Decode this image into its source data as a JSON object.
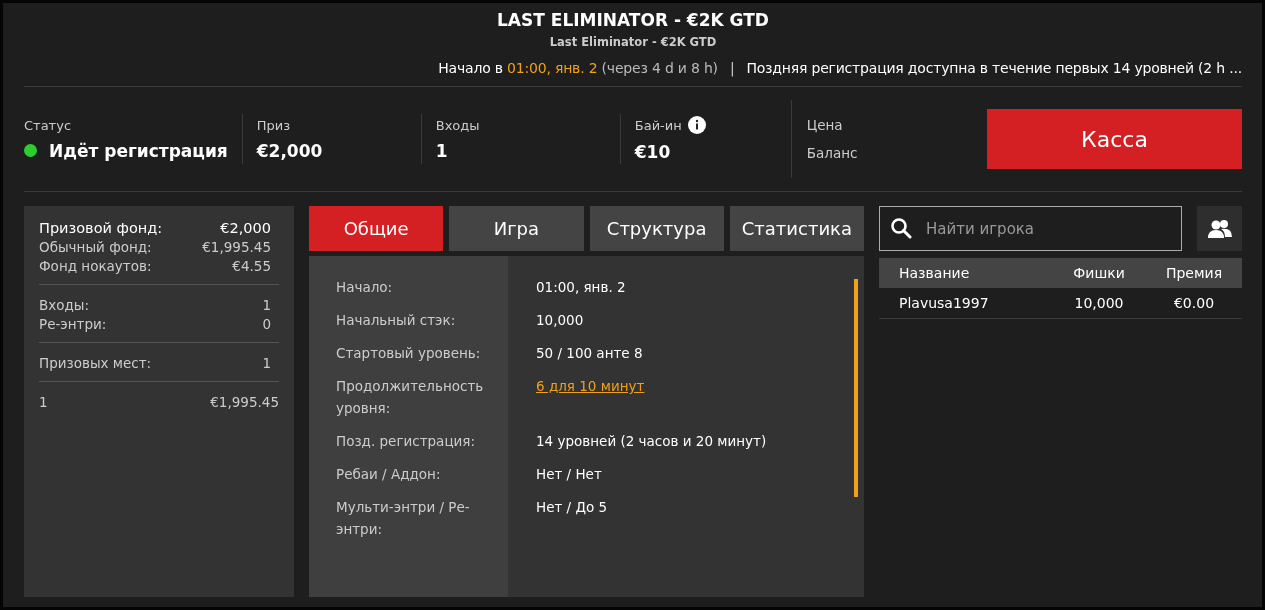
{
  "header": {
    "title": "LAST ELIMINATOR - €2K GTD",
    "subtitle": "Last Eliminator - €2K GTD",
    "start": {
      "prefix": "Начало в ",
      "time": "01:00, янв. 2",
      "suffix": " (через 4 d и 8 h)"
    },
    "separator": "|",
    "late_registration": "Поздняя регистрация доступна в течение первых 14 уровней (2 h ..."
  },
  "stats": [
    {
      "label": "Статус",
      "value": "Идёт регистрация",
      "kind": "status"
    },
    {
      "label": "Приз",
      "value": "€2,000",
      "kind": "plain"
    },
    {
      "label": "Входы",
      "value": "1",
      "kind": "plain"
    },
    {
      "label": "Бай-ин",
      "value": "€10",
      "kind": "info"
    }
  ],
  "balance": {
    "price_label": "Цена",
    "balance_label": "Баланс"
  },
  "cashier_button": "Касса",
  "summary": [
    [
      {
        "label": "Призовой фонд:",
        "value": "€2,000",
        "bold": true
      },
      {
        "label": "Обычный фонд:",
        "value": "€1,995.45",
        "bold": false
      },
      {
        "label": "Фонд нокаутов:",
        "value": "€4.55",
        "bold": false
      }
    ],
    [
      {
        "label": "Входы:",
        "value": "1",
        "bold": false
      },
      {
        "label": "Ре-энтри:",
        "value": "0",
        "bold": false
      }
    ],
    [
      {
        "label": "Призовых мест:",
        "value": "1",
        "bold": false
      }
    ],
    [
      {
        "label": "1",
        "value": "€1,995.45",
        "bold": false
      }
    ]
  ],
  "tabs": [
    {
      "label": "Общие",
      "selected": true
    },
    {
      "label": "Игра",
      "selected": false
    },
    {
      "label": "Структура",
      "selected": false
    },
    {
      "label": "Статистика",
      "selected": false
    }
  ],
  "details": [
    {
      "label": "Начало:",
      "value": "01:00, янв. 2",
      "kind": "text"
    },
    {
      "label": "Начальный стэк:",
      "value": "10,000",
      "kind": "text"
    },
    {
      "label": "Стартовый уровень:",
      "value": "50 / 100 анте 8",
      "kind": "text"
    },
    {
      "label": "Продолжительность уровня:",
      "value": "6 для 10 минут",
      "kind": "link"
    },
    {
      "label": "Позд. регистрация:",
      "value": "14 уровней (2 часов и 20 минут)",
      "kind": "text"
    },
    {
      "label": "Ребаи / Аддон:",
      "value": "Нет / Нет",
      "kind": "text"
    },
    {
      "label": "Мульти-энтри / Ре-энтри:",
      "value": "Нет / До 5",
      "kind": "text"
    }
  ],
  "player_search": {
    "placeholder": "Найти игрока"
  },
  "players": {
    "columns": [
      "Название",
      "Фишки",
      "Премия"
    ],
    "rows": [
      [
        "Plavusa1997",
        "10,000",
        "€0.00"
      ]
    ]
  }
}
